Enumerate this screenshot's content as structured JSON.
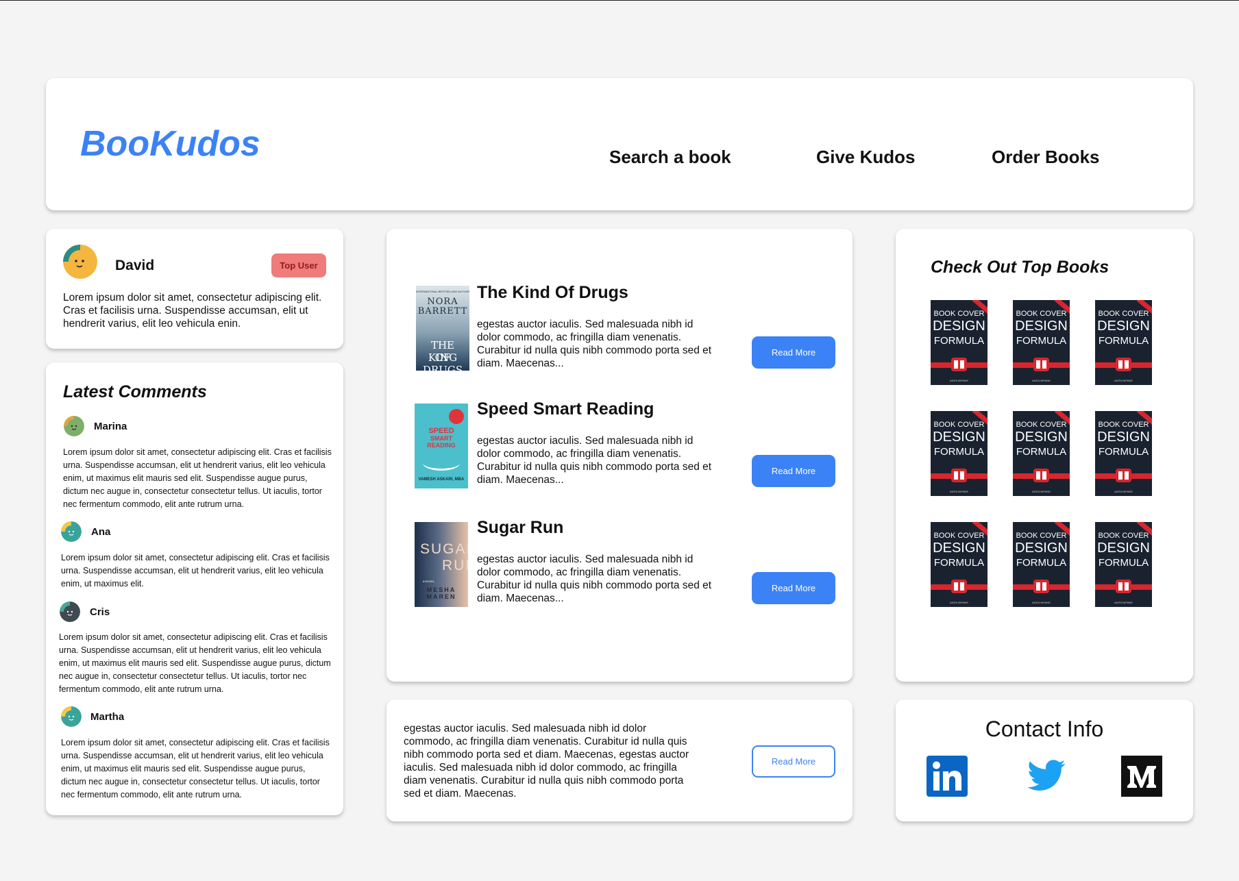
{
  "header": {
    "logo": "BooKudos",
    "nav": [
      "Search a book",
      "Give Kudos",
      "Order Books"
    ]
  },
  "user": {
    "name": "David",
    "badge": "Top User",
    "bio": "Lorem ipsum dolor sit amet, consectetur adipiscing elit. Cras et facilisis urna. Suspendisse accumsan, elit ut hendrerit varius, elit leo vehicula enin."
  },
  "comments": {
    "title": "Latest Comments",
    "items": [
      {
        "name": "Marina",
        "text": "Lorem ipsum dolor sit amet, consectetur adipiscing elit. Cras et facilisis urna. Suspendisse accumsan, elit ut hendrerit varius, elit leo vehicula enim, ut maximus elit mauris sed elit. Suspendisse augue purus, dictum nec augue in, consectetur consectetur tellus. Ut iaculis, tortor nec fermentum commodo, elit ante rutrum urna."
      },
      {
        "name": "Ana",
        "text": "Lorem ipsum dolor sit amet, consectetur adipiscing elit. Cras et facilisis urna. Suspendisse accumsan, elit ut hendrerit varius, elit leo vehicula enim, ut maximus elit."
      },
      {
        "name": "Cris",
        "text": "Lorem ipsum dolor sit amet, consectetur adipiscing elit. Cras et facilisis urna. Suspendisse accumsan, elit ut hendrerit varius, elit leo vehicula enim, ut maximus elit mauris sed elit. Suspendisse augue purus, dictum nec augue in, consectetur consectetur tellus. Ut iaculis, tortor nec fermentum commodo, elit ante rutrum urna."
      },
      {
        "name": "Martha",
        "text": "Lorem ipsum dolor sit amet, consectetur adipiscing elit. Cras et facilisis urna. Suspendisse accumsan, elit ut hendrerit varius, elit leo vehicula enim, ut maximus elit mauris sed elit. Suspendisse augue purus, dictum nec augue in, consectetur consectetur tellus. Ut iaculis, tortor nec fermentum commodo, elit ante rutrum urna."
      }
    ]
  },
  "books": [
    {
      "title": "The Kind Of Drugs",
      "desc": "egestas auctor iaculis. Sed malesuada nibh id dolor commodo, ac fringilla diam venenatis. Curabitur id nulla quis nibh commodo porta sed et diam. Maecenas...",
      "button": "Read More",
      "cover": {
        "top_line": "INTERNATIONAL BESTSELLING AUTHOR",
        "author_1": "NORA",
        "author_2": "BARRETT",
        "title_1": "THE KING",
        "title_2": "OF DRUGS"
      }
    },
    {
      "title": "Speed Smart Reading",
      "desc": "egestas auctor iaculis. Sed malesuada nibh id dolor commodo, ac fringilla diam venenatis. Curabitur id nulla quis nibh commodo porta sed et diam. Maecenas...",
      "button": "Read More",
      "cover": {
        "title_1": "SPEED",
        "title_2": "SMART",
        "title_3": "READING",
        "author": "VAMESH ASKARI, MBA"
      }
    },
    {
      "title": "Sugar Run",
      "desc": "egestas auctor iaculis. Sed malesuada nibh id dolor commodo, ac fringilla diam venenatis. Curabitur id nulla quis nibh commodo porta sed et diam. Maecenas...",
      "button": "Read More",
      "cover": {
        "title_1": "SUGAR",
        "title_2": "RUN",
        "subtitle": "A NOVEL",
        "author": "MESHA MAREN"
      }
    }
  ],
  "promo": {
    "text": "egestas auctor iaculis. Sed malesuada nibh id dolor commodo, ac fringilla diam venenatis. Curabitur id nulla quis nibh commodo porta sed et diam. Maecenas, egestas auctor iaculis. Sed malesuada nibh id dolor commodo, ac fringilla diam venenatis. Curabitur id nulla quis nibh commodo porta sed et diam. Maecenas.",
    "button": "Read More"
  },
  "top_books": {
    "title": "Check Out Top Books",
    "cover": {
      "line1": "BOOK COVER",
      "line2": "DESIGN",
      "line3": "FORMULA",
      "author": "ANITA NIPANE"
    },
    "count": 9
  },
  "contact": {
    "title": "Contact Info",
    "icons": [
      "linkedin-icon",
      "twitter-icon",
      "medium-icon"
    ]
  },
  "colors": {
    "accent": "#3b82f6",
    "badge": "#ef7b7b",
    "linkedin": "#0a66c2",
    "twitter": "#1da1f2"
  }
}
